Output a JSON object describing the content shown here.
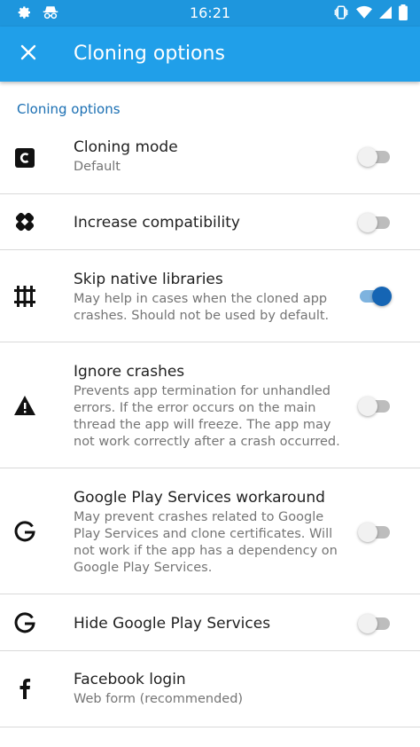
{
  "status_bar": {
    "time": "16:21",
    "left_icons": [
      "gear-icon",
      "incognito-icon"
    ],
    "right_icons": [
      "vibrate-icon",
      "wifi-icon",
      "signal-icon",
      "battery-icon"
    ]
  },
  "app_bar": {
    "title": "Cloning options",
    "close_icon": "close-icon"
  },
  "section_header": "Cloning options",
  "items": [
    {
      "icon": "cloning-mode-icon",
      "title": "Cloning mode",
      "subtitle": "Default",
      "toggle": false
    },
    {
      "icon": "bandage-icon",
      "title": "Increase compatibility",
      "subtitle": "",
      "toggle": false
    },
    {
      "icon": "native-libraries-icon",
      "title": "Skip native libraries",
      "subtitle": "May help in cases when the cloned app crashes. Should not be used by default.",
      "toggle": true
    },
    {
      "icon": "warning-icon",
      "title": "Ignore crashes",
      "subtitle": "Prevents app termination for unhandled errors. If the error occurs on the main thread the app will freeze. The app may not work correctly after a crash occurred.",
      "toggle": false
    },
    {
      "icon": "google-icon",
      "title": "Google Play Services workaround",
      "subtitle": "May prevent crashes related to Google Play Services and clone certificates. Will not work if the app has a dependency on Google Play Services.",
      "toggle": false
    },
    {
      "icon": "google-icon",
      "title": "Hide Google Play Services",
      "subtitle": "",
      "toggle": false
    },
    {
      "icon": "facebook-icon",
      "title": "Facebook login",
      "subtitle": "Web form (recommended)"
    }
  ],
  "colors": {
    "status_bar": "#1e96dd",
    "app_bar": "#209fe9",
    "accent": "#1565b4",
    "section_header": "#1a6fb3"
  }
}
